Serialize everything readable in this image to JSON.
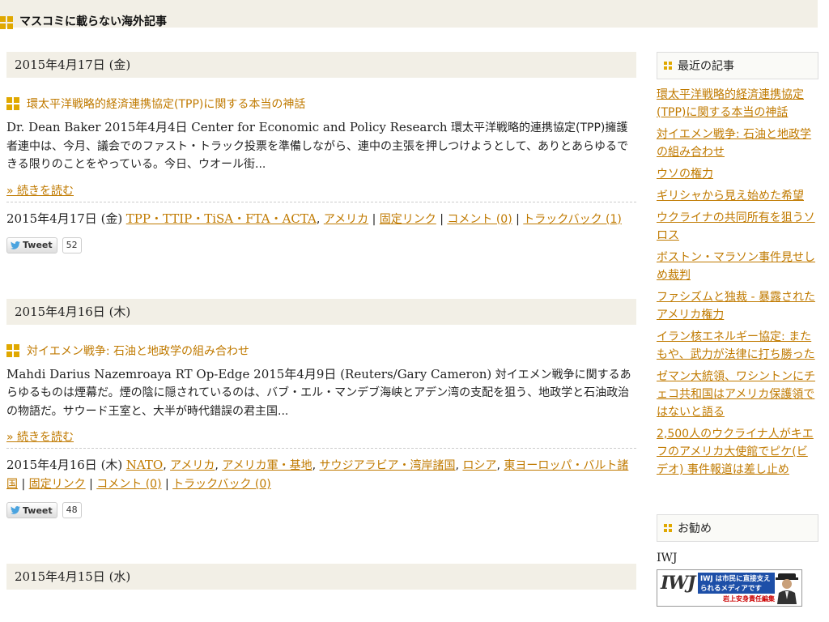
{
  "blog": {
    "title": "マスコミに載らない海外記事"
  },
  "entries": [
    {
      "date_heading": "2015年4月17日 (金)",
      "title": "環太平洋戦略的経済連携協定(TPP)に関する本当の神話",
      "body_en": "Dr. Dean Baker 2015年4月4日 Center for Economic and Policy Research",
      "body_ja": " 環太平洋戦略的連携協定(TPP)擁護者連中は、今月、議会でのファスト・トラック投票を準備しながら、連中の主張を押しつけようとして、ありとあらゆるできる限りのことをやっている。今日、ウオール街...",
      "more": "» 続きを読む",
      "footer_date": "2015年4月17日 (金)",
      "categories": [
        "TPP・TTIP・TiSA・FTA・ACTA",
        "アメリカ"
      ],
      "permalink": "固定リンク",
      "comments": "コメント (0)",
      "trackbacks": "トラックバック (1)",
      "tweet_label": "Tweet",
      "tweet_count": "52"
    },
    {
      "date_heading": "2015年4月16日 (木)",
      "title": "対イエメン戦争: 石油と地政学の組み合わせ",
      "body_en": "Mahdi Darius Nazemroaya RT Op-Edge 2015年4月9日 (Reuters/Gary Cameron)",
      "body_ja": " 対イエメン戦争に関するあらゆるものは煙幕だ。煙の陰に隠されているのは、バブ・エル・マンデブ海峡とアデン湾の支配を狙う、地政学と石油政治の物語だ。サウード王室と、大半が時代錯誤の君主国...",
      "more": "» 続きを読む",
      "footer_date": "2015年4月16日 (木)",
      "categories": [
        "NATO",
        "アメリカ",
        "アメリカ軍・基地",
        "サウジアラビア・湾岸諸国",
        "ロシア",
        "東ヨーロッパ・バルト諸国"
      ],
      "permalink": "固定リンク",
      "comments": "コメント (0)",
      "trackbacks": "トラックバック (0)",
      "tweet_label": "Tweet",
      "tweet_count": "48"
    },
    {
      "date_heading": "2015年4月15日 (水)"
    }
  ],
  "sidebar": {
    "recent_heading": "最近の記事",
    "recent": [
      "環太平洋戦略的経済連携協定(TPP)に関する本当の神話",
      "対イエメン戦争: 石油と地政学の組み合わせ",
      "ウソの権力",
      "ギリシャから見え始めた希望",
      "ウクライナの共同所有を狙うソロス",
      "ボストン・マラソン事件見せしめ裁判",
      "ファシズムと独裁 - 暴露されたアメリカ権力",
      "イラン核エネルギー協定: またもや、武力が法律に打ち勝った",
      "ゼマン大統領、ワシントンにチェコ共和国はアメリカ保護領ではないと語る",
      "2,500人のウクライナ人がキエフのアメリカ大使館でピケ(ビデオ) 事件報道は差し止め"
    ],
    "rec_heading": "お勧め",
    "rec_label": "IWJ",
    "banner": {
      "logo": "IWJ",
      "blue_text": "IWJ は市民に直接支えられるメディアです",
      "red_text": "岩上安身責任編集"
    }
  },
  "colors": {
    "link": "#c07a00",
    "accent_square": "#e0a800",
    "date_band": "#f2efe6"
  },
  "icons": {
    "entry_marker": "four-squares-icon",
    "tweet": "twitter-bird-icon"
  }
}
